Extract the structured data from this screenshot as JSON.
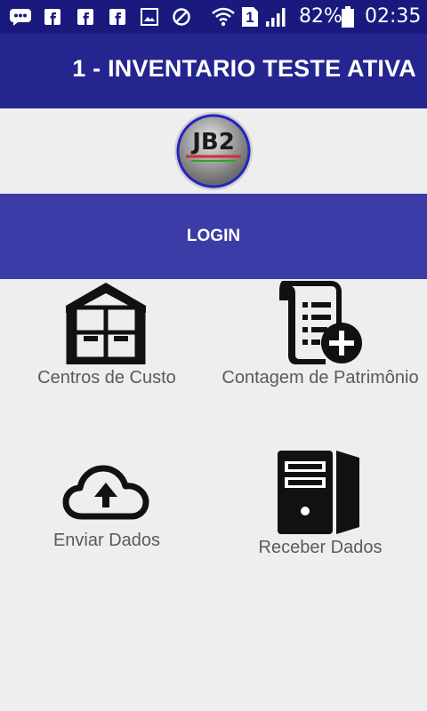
{
  "status_bar": {
    "battery_percent": "82%",
    "time": "02:35",
    "sim_slot": "1",
    "icons": [
      "chat-icon",
      "facebook-icon",
      "facebook-icon",
      "facebook-icon",
      "gallery-icon",
      "blocked-icon",
      "wifi-icon",
      "sim-icon",
      "signal-icon",
      "battery-icon"
    ]
  },
  "app_bar": {
    "title": "1 - INVENTARIO TESTE ATIVA"
  },
  "logo": {
    "text": "JB2",
    "icon": "jb2-logo"
  },
  "login": {
    "label": "LOGIN"
  },
  "menu": {
    "items": [
      {
        "label": "Centros de Custo",
        "icon": "warehouse-icon"
      },
      {
        "label": "Contagem de Patrimônio",
        "icon": "add-document-icon"
      },
      {
        "label": "Enviar Dados",
        "icon": "cloud-upload-icon"
      },
      {
        "label": "Receber Dados",
        "icon": "server-icon"
      }
    ]
  },
  "colors": {
    "status_bar": "#1a1a7e",
    "app_bar": "#25258f",
    "login_button": "#3b3ca7",
    "background": "#eeeeee",
    "label_text": "#5a5a5a"
  }
}
